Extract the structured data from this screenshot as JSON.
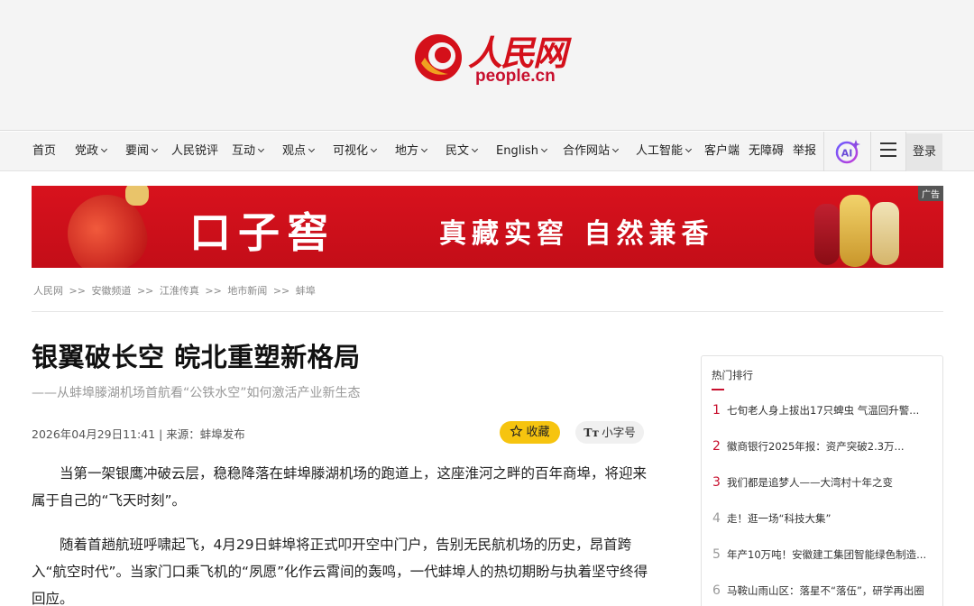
{
  "header": {
    "logo_cn": "人民网",
    "logo_en": "people.cn"
  },
  "nav": {
    "items": [
      {
        "label": "首页",
        "dropdown": false
      },
      {
        "label": "党政",
        "dropdown": true
      },
      {
        "label": "要闻",
        "dropdown": true
      },
      {
        "label": "人民锐评",
        "dropdown": false
      },
      {
        "label": "互动",
        "dropdown": true
      },
      {
        "label": "观点",
        "dropdown": true
      },
      {
        "label": "可视化",
        "dropdown": true
      },
      {
        "label": "地方",
        "dropdown": true
      },
      {
        "label": "民文",
        "dropdown": true
      },
      {
        "label": "English",
        "dropdown": true
      },
      {
        "label": "合作网站",
        "dropdown": true
      },
      {
        "label": "人工智能",
        "dropdown": true
      },
      {
        "label": "客户端",
        "dropdown": false
      },
      {
        "label": "无障碍",
        "dropdown": false
      },
      {
        "label": "举报",
        "dropdown": false
      }
    ],
    "ai_icon": "ai-sparkle-icon",
    "menu_icon": "hamburger-menu-icon",
    "login_label": "登录"
  },
  "ad": {
    "tag": "广告",
    "brand": "口子窖",
    "slogan": "真藏实窖 自然兼香",
    "colors": {
      "background": "#d0101b"
    }
  },
  "breadcrumb": [
    "人民网",
    "安徽频道",
    "江淮传真",
    "地市新闻",
    "蚌埠"
  ],
  "breadcrumb_sep": ">>",
  "article": {
    "title": "银翼破长空 皖北重塑新格局",
    "subtitle": "——从蚌埠滕湖机场首航看“公铁水空”如何激活产业新生态",
    "meta": "2026年04月29日11:41 | 来源：蚌埠发布",
    "favorite_label": "收藏",
    "font_size_label": "小字号",
    "paragraphs": [
      "当第一架银鹰冲破云层，稳稳降落在蚌埠滕湖机场的跑道上，这座淮河之畔的百年商埠，将迎来属于自己的“飞天时刻”。",
      "随着首趟航班呼啸起飞，4月29日蚌埠将正式叩开空中门户，告别无民航机场的历史，昂首跨入“航空时代”。当家门口乘飞机的“夙愿”化作云霄间的轰鸣，一代蚌埠人的热切期盼与执着坚守终得回应。"
    ]
  },
  "hot": {
    "title": "热门排行",
    "items": [
      {
        "rank": "1",
        "text": "七旬老人身上拔出17只蜱虫 气温回升警..."
      },
      {
        "rank": "2",
        "text": "徽商银行2025年报：资产突破2.3万..."
      },
      {
        "rank": "3",
        "text": "我们都是追梦人——大湾村十年之变"
      },
      {
        "rank": "4",
        "text": "走！逛一场“科技大集”"
      },
      {
        "rank": "5",
        "text": "年产10万吨！安徽建工集团智能绿色制造..."
      },
      {
        "rank": "6",
        "text": "马鞍山雨山区：落星不“落伍”，研学再出圈"
      }
    ],
    "colors": {
      "accent": "#c8102e",
      "muted": "#999999"
    }
  }
}
